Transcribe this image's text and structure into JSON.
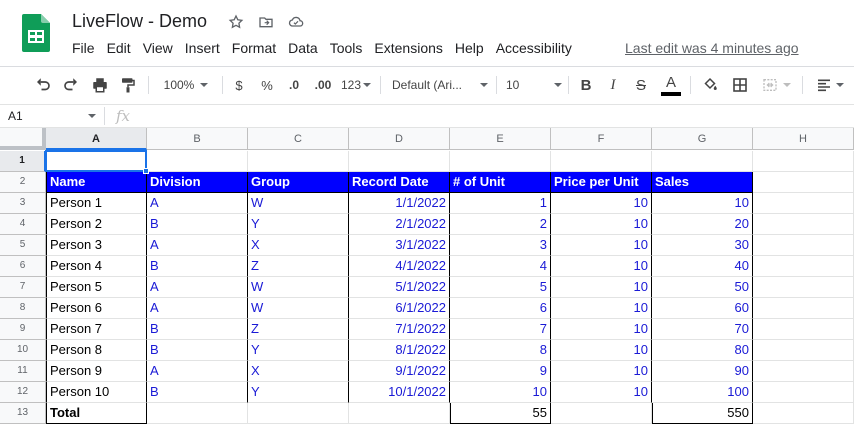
{
  "app": {
    "title": "LiveFlow - Demo",
    "last_edit": "Last edit was 4 minutes ago",
    "brand_color": "#0f9d58"
  },
  "menu": [
    "File",
    "Edit",
    "View",
    "Insert",
    "Format",
    "Data",
    "Tools",
    "Extensions",
    "Help",
    "Accessibility"
  ],
  "toolbar": {
    "zoom": "100%",
    "currency": "$",
    "percent": "%",
    "decrease_decimal": ".0",
    "increase_decimal": ".00",
    "more_formats": "123",
    "font": "Default (Ari...",
    "font_size": "10",
    "bold": "B",
    "italic": "I",
    "strikethrough": "S",
    "text_color": "A"
  },
  "formula_bar": {
    "name_box": "A1",
    "fx": "fx"
  },
  "columns": [
    "A",
    "B",
    "C",
    "D",
    "E",
    "F",
    "G",
    "H"
  ],
  "rows": [
    "1",
    "2",
    "3",
    "4",
    "5",
    "6",
    "7",
    "8",
    "9",
    "10",
    "11",
    "12",
    "13"
  ],
  "table": {
    "headers": [
      "Name",
      "Division",
      "Group",
      "Record Date",
      "# of Unit",
      "Price per Unit",
      "Sales"
    ],
    "data": [
      [
        "Person 1",
        "A",
        "W",
        "1/1/2022",
        "1",
        "10",
        "10"
      ],
      [
        "Person 2",
        "B",
        "Y",
        "2/1/2022",
        "2",
        "10",
        "20"
      ],
      [
        "Person 3",
        "A",
        "X",
        "3/1/2022",
        "3",
        "10",
        "30"
      ],
      [
        "Person 4",
        "B",
        "Z",
        "4/1/2022",
        "4",
        "10",
        "40"
      ],
      [
        "Person 5",
        "A",
        "W",
        "5/1/2022",
        "5",
        "10",
        "50"
      ],
      [
        "Person 6",
        "A",
        "W",
        "6/1/2022",
        "6",
        "10",
        "60"
      ],
      [
        "Person 7",
        "B",
        "Z",
        "7/1/2022",
        "7",
        "10",
        "70"
      ],
      [
        "Person 8",
        "B",
        "Y",
        "8/1/2022",
        "8",
        "10",
        "80"
      ],
      [
        "Person 9",
        "A",
        "X",
        "9/1/2022",
        "9",
        "10",
        "90"
      ],
      [
        "Person 10",
        "B",
        "Y",
        "10/1/2022",
        "10",
        "10",
        "100"
      ]
    ],
    "total_label": "Total",
    "total_units": "55",
    "total_sales": "550"
  },
  "colors": {
    "header_fill": "#0000ff",
    "data_text": "#1a1ad6",
    "selection": "#1a73e8"
  }
}
